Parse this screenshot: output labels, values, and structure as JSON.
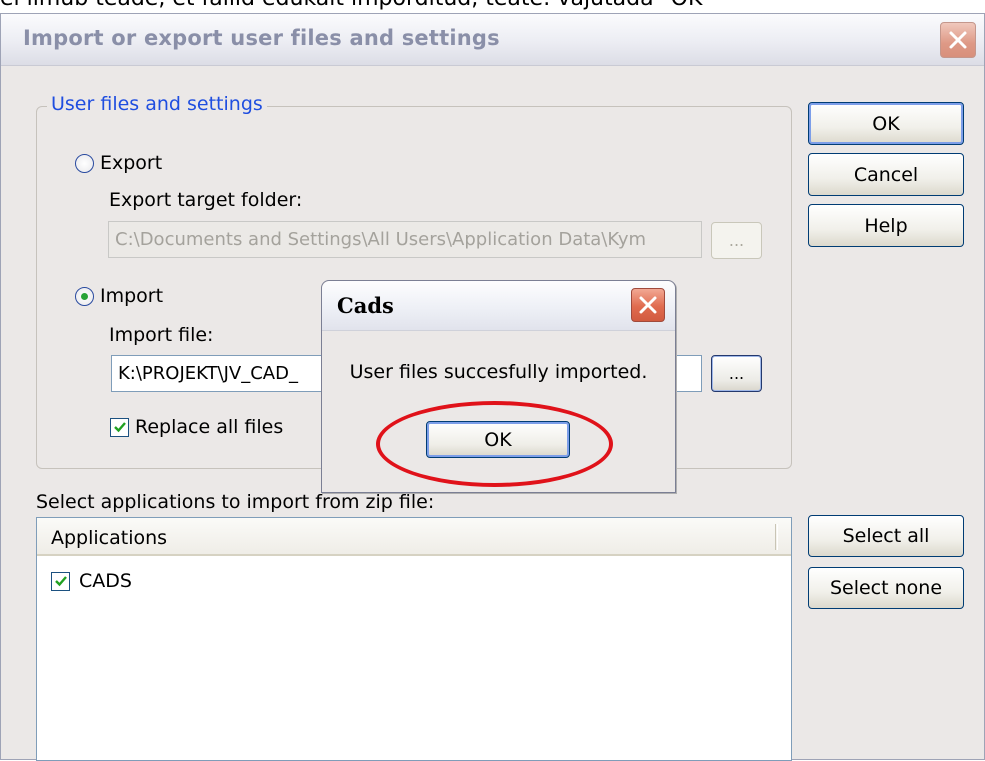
{
  "caption": "ei iimub teade, et failid edukalt imporditud, teate: vajutada \"OK\"",
  "main": {
    "title": "Import or export user files and settings",
    "group_label": "User files and settings",
    "export_label": "Export",
    "export_selected": false,
    "export_folder_label": "Export target folder:",
    "export_folder_value": "C:\\Documents and Settings\\All Users\\Application Data\\Kym",
    "import_label": "Import",
    "import_selected": true,
    "import_file_label": "Import file:",
    "import_file_value": "K:\\PROJEKT\\JV_CAD_",
    "browse_label": "...",
    "replace_label": "Replace all files",
    "replace_checked": true,
    "ok_label": "OK",
    "cancel_label": "Cancel",
    "help_label": "Help",
    "apps_caption": "Select applications to import from zip file:",
    "apps_header": "Applications",
    "apps": [
      {
        "label": "CADS",
        "checked": true
      }
    ],
    "select_all_label": "Select all",
    "select_none_label": "Select none"
  },
  "dialog": {
    "title": "Cads",
    "message": "User files succesfully imported.",
    "ok_label": "OK"
  },
  "colors": {
    "group_label": "#1f4ee0",
    "highlight": "#e0121a",
    "window_bg": "#ebe8e7"
  }
}
